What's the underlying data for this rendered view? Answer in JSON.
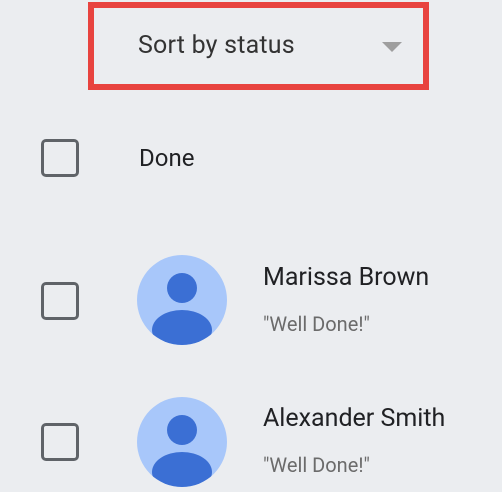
{
  "sort": {
    "label": "Sort by status",
    "highlight_color": "#e8433f"
  },
  "groups": [
    {
      "header": "Done"
    }
  ],
  "contacts": [
    {
      "name": "Marissa Brown",
      "status": "\"Well Done!\"",
      "avatar_icon": "person-avatar-icon",
      "checked": false
    },
    {
      "name": "Alexander Smith",
      "status": "\"Well Done!\"",
      "avatar_icon": "person-avatar-icon",
      "checked": false
    }
  ],
  "colors": {
    "background": "#ebedf0",
    "avatar_bg": "#a8c7fa",
    "avatar_fg": "#3b6fd4"
  }
}
